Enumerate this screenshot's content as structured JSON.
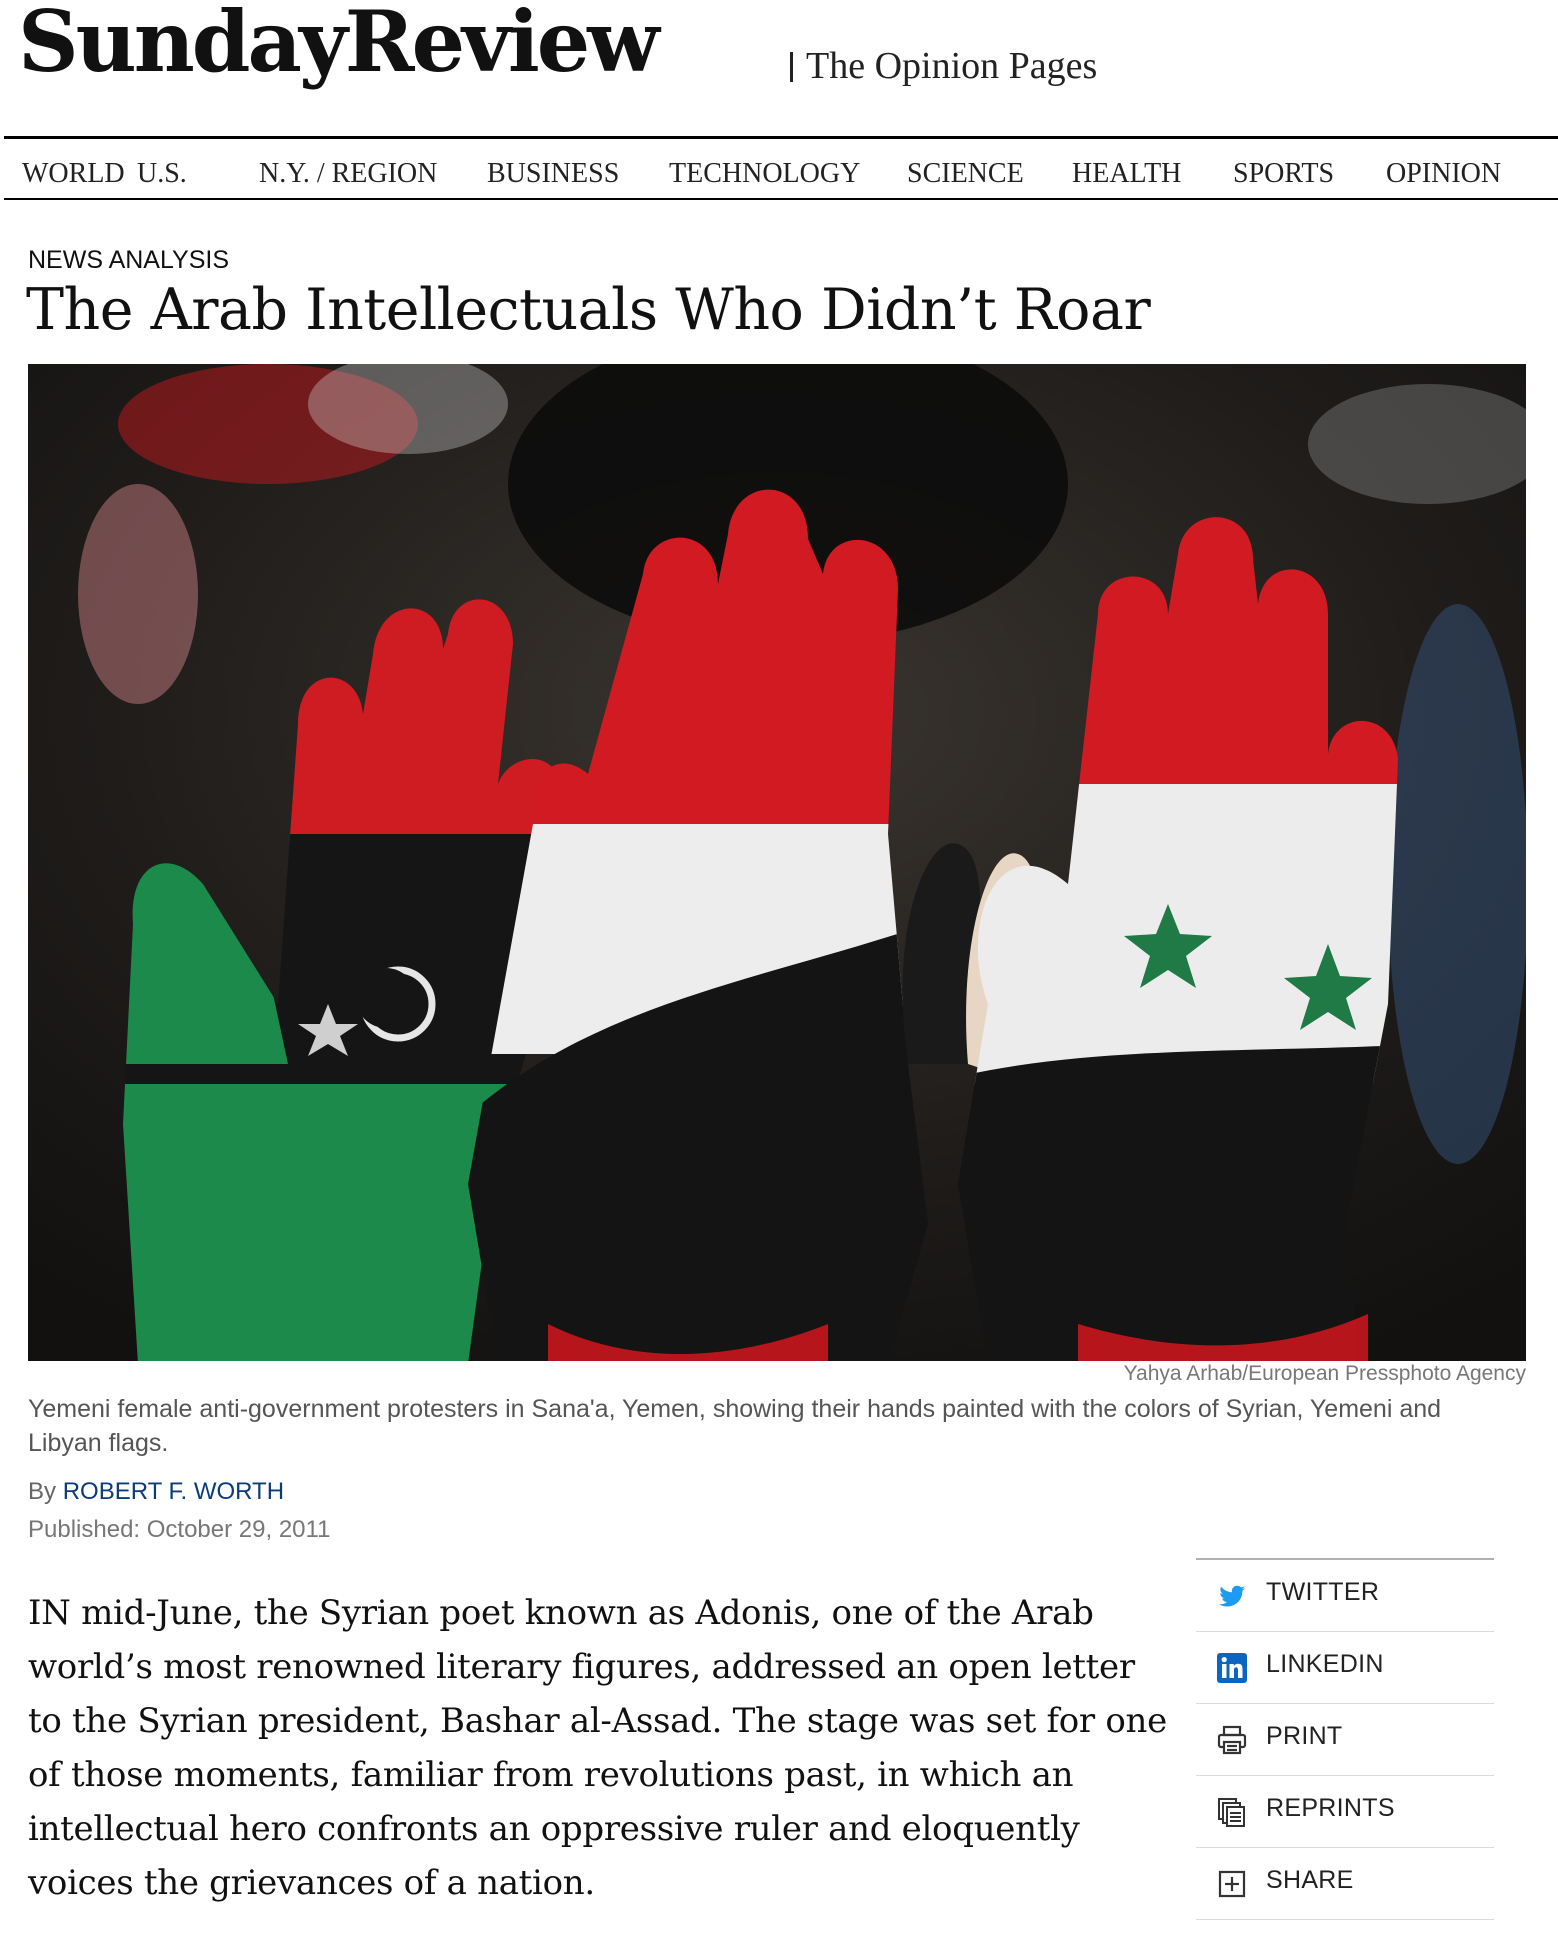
{
  "masthead": {
    "title": "SundayReview",
    "subtitle": "The Opinion Pages"
  },
  "nav": {
    "items": [
      "WORLD",
      "U.S.",
      "N.Y. / REGION",
      "BUSINESS",
      "TECHNOLOGY",
      "SCIENCE",
      "HEALTH",
      "SPORTS",
      "OPINION"
    ]
  },
  "article": {
    "kicker": "NEWS ANALYSIS",
    "headline": "The Arab Intellectuals Who Didn’t Roar",
    "photo_credit": "Yahya Arhab/European Pressphoto Agency",
    "caption": "Yemeni female anti-government protesters in Sana'a, Yemen, showing their hands painted with the colors of Syrian, Yemeni and Libyan flags.",
    "byline_prefix": "By",
    "author": "ROBERT F. WORTH",
    "published": "Published: October 29, 2011",
    "body": "IN mid-June, the Syrian poet known as Adonis, one of the Arab world’s most renowned literary figures, addressed an open letter to the Syrian president, Bashar al-Assad. The stage was set for one of those moments, familiar from revolutions past, in which an intellectual hero confronts an oppressive ruler and eloquently voices the grievances of a nation."
  },
  "tools": {
    "items": [
      {
        "label": "TWITTER",
        "icon": "twitter-bird-icon"
      },
      {
        "label": "LINKEDIN",
        "icon": "linkedin-icon"
      },
      {
        "label": "PRINT",
        "icon": "printer-icon"
      },
      {
        "label": "REPRINTS",
        "icon": "reprints-icon"
      },
      {
        "label": "SHARE",
        "icon": "share-plus-icon"
      }
    ]
  },
  "colors": {
    "author_link": "#0b3c7a",
    "twitter_blue": "#1d9bf0",
    "linkedin_blue": "#0a66c2",
    "flag_red": "#d1131c",
    "flag_green": "#1f8a4c"
  }
}
